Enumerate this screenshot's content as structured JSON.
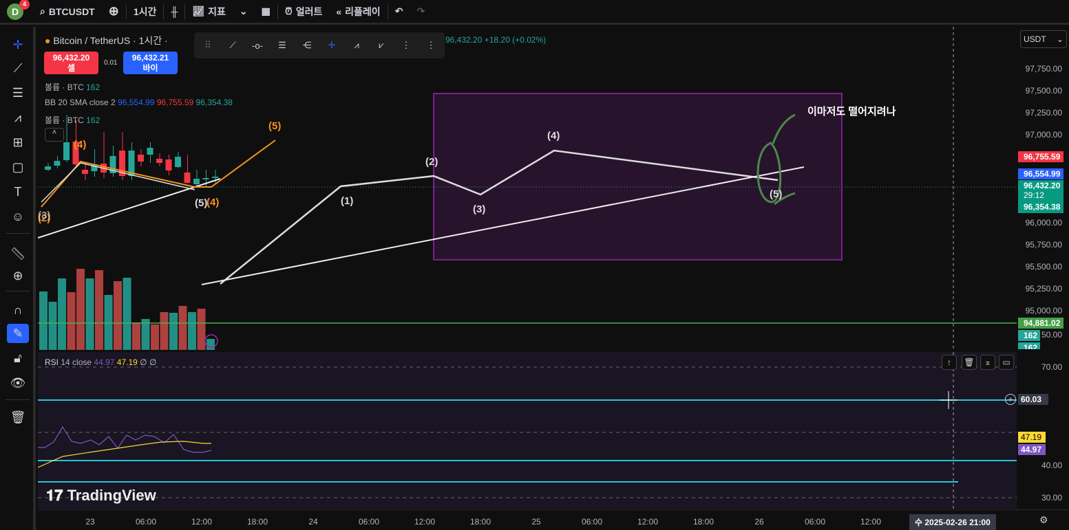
{
  "topbar": {
    "avatar_letter": "D",
    "notif_count": "4",
    "symbol": "BTCUSDT",
    "interval": "1시간",
    "indicators": "지표",
    "alert": "얼러트",
    "replay": "리플레이"
  },
  "legend": {
    "title": "Bitcoin / TetherUS · 1시간 ·",
    "change": "96,432.20 +18.20 (+0.02%)",
    "sell_price": "96,432.20",
    "sell_label": "셀",
    "spread": "0.01",
    "buy_price": "96,432.21",
    "buy_label": "바이",
    "volume1_label": "볼륨 · BTC",
    "volume1_value": "162",
    "bb_label": "BB 20 SMA close 2",
    "bb_basis": "96,554.99",
    "bb_upper": "96,755.59",
    "bb_lower": "96,354.38",
    "volume2_label": "볼륨 · BTC",
    "volume2_value": "162"
  },
  "annotations": {
    "comment": "이마저도 떨어지려나",
    "w1": "(1)",
    "w2": "(2)",
    "w3": "(3)",
    "w4": "(4)",
    "w5": "(5)",
    "o5": "(5)",
    "o4": "(4)",
    "o3": "(3)",
    "o2": "(2)",
    "l5": "(5)",
    "l4": "(4)"
  },
  "price_axis": {
    "currency": "USDT",
    "ticks": [
      "97,750.00",
      "97,500.00",
      "97,250.00",
      "97,000.00",
      "96,000.00",
      "95,750.00",
      "95,500.00",
      "95,250.00",
      "95,000.00"
    ],
    "bb_upper": "96,755.59",
    "bb_basis": "96,554.99",
    "last": "96,432.20",
    "countdown": "29:12",
    "bb_lower": "96,354.38",
    "hline": "94,881.02",
    "vol1": "162",
    "vol2": "162",
    "vol_tick_partial": "50.00"
  },
  "rsi": {
    "label": "RSI",
    "params": "14 close",
    "value": "44.97",
    "ma": "47.19",
    "na1": "∅",
    "na2": "∅",
    "ticks": [
      "70.00",
      "60.03",
      "40.00",
      "30.00"
    ],
    "tag_ma": "47.19",
    "tag_value": "44.97",
    "cursor_value": "60.03"
  },
  "time_axis": {
    "ticks": [
      "23",
      "06:00",
      "12:00",
      "18:00",
      "24",
      "06:00",
      "12:00",
      "18:00",
      "25",
      "06:00",
      "12:00",
      "18:00",
      "26",
      "06:00",
      "12:00"
    ],
    "cursor": "수 2025-02-26  21:00"
  },
  "watermark": "TradingView",
  "colors": {
    "up": "#26a69a",
    "down": "#f23645",
    "accent": "#2962ff",
    "orange": "#f7931a",
    "box": "#9c27b0"
  }
}
